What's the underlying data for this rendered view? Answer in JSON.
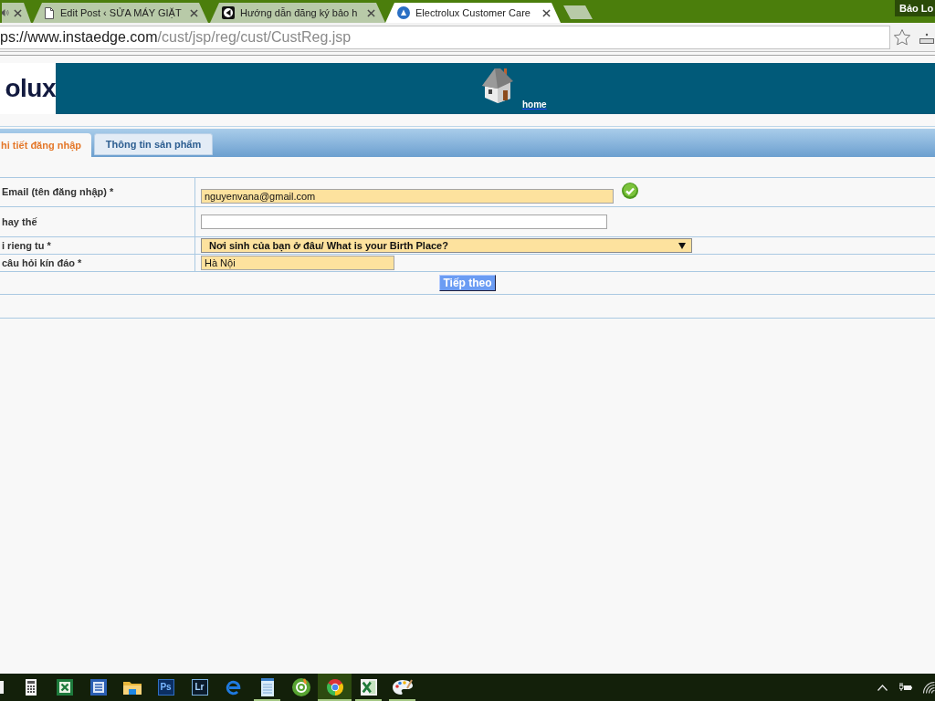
{
  "browser": {
    "tabs": [
      {
        "kind": "audio",
        "selected": false
      },
      {
        "kind": "page",
        "title": "Edit Post ‹ SỬA MÁY GIẶT",
        "selected": false
      },
      {
        "kind": "square",
        "title": "Hướng dẫn đăng ký bảo h",
        "selected": false
      },
      {
        "kind": "circle",
        "title": "Electrolux Customer Care",
        "selected": true
      }
    ],
    "profile": "Bảo Lo",
    "address": {
      "host": "ps://www.instaedge.com",
      "path": "/cust/jsp/reg/cust/CustReg.jsp"
    }
  },
  "header": {
    "logo": "olux",
    "home_link": "home"
  },
  "form_tabs": [
    {
      "label": "hi tiết đăng nhập",
      "selected": true
    },
    {
      "label": "Thông tin sản phẩm",
      "selected": false
    }
  ],
  "form": {
    "rows": [
      {
        "kind": "input",
        "label": "Email (tên đăng nhập) *",
        "value": "nguyenvana@gmail.com",
        "autofilled": true,
        "valid": true
      },
      {
        "kind": "input",
        "label": "hay thế",
        "autofilled": false,
        "valid": false
      },
      {
        "kind": "select",
        "label": "i rieng tu *",
        "value": "Nơi sinh của bạn ở đâu/ What is your Birth Place?",
        "autofilled": true,
        "valid": false
      },
      {
        "kind": "input",
        "label": "câu hỏi kín đáo *",
        "value": "Hà Nội",
        "autofilled": true,
        "valid": false
      }
    ],
    "submit": "Tiếp theo"
  },
  "taskbar": {
    "apps": [
      {
        "kind": "clipped",
        "running": false,
        "active": false
      },
      {
        "kind": "calculator",
        "running": false,
        "active": false
      },
      {
        "kind": "sheet",
        "running": false,
        "active": false
      },
      {
        "kind": "doc",
        "running": false,
        "active": false
      },
      {
        "kind": "folder",
        "running": false,
        "active": false
      },
      {
        "kind": "tile",
        "label": "Ps",
        "running": false,
        "active": false
      },
      {
        "kind": "framedtile",
        "label": "Lr",
        "running": false,
        "active": false
      },
      {
        "kind": "swirl",
        "running": false,
        "active": false
      },
      {
        "kind": "notepad",
        "running": true,
        "active": false
      },
      {
        "kind": "disc",
        "running": false,
        "active": false
      },
      {
        "kind": "orb",
        "running": true,
        "active": true
      },
      {
        "kind": "xsheet",
        "running": true,
        "active": false
      },
      {
        "kind": "palette",
        "running": true,
        "active": false
      }
    ]
  }
}
